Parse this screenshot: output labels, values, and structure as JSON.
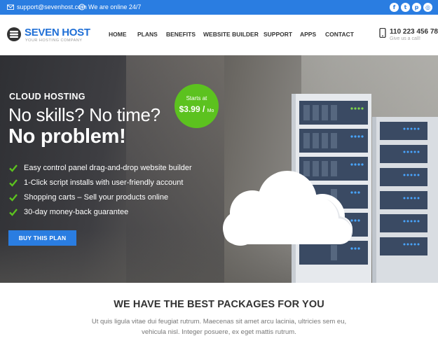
{
  "topbar": {
    "email": "support@sevenhost.com",
    "status": "We are online 24/7",
    "social": [
      {
        "name": "facebook-icon",
        "glyph": "f"
      },
      {
        "name": "twitter-icon",
        "glyph": "t"
      },
      {
        "name": "pinterest-icon",
        "glyph": "p"
      },
      {
        "name": "instagram-icon",
        "glyph": "◎"
      }
    ]
  },
  "header": {
    "logo_part1": "SEVEN",
    "logo_part2": "HOST",
    "tagline": "YOUR HOSTING COMPANY",
    "nav": [
      "HOME",
      "PLANS",
      "BENEFITS",
      "WEBSITE BUILDER",
      "SUPPORT",
      "APPS",
      "CONTACT"
    ],
    "phone": "110 223 456 78",
    "phone_sub": "Give us a call!"
  },
  "hero": {
    "kicker": "CLOUD HOSTING",
    "headline": "No skills? No time?",
    "headline_bold": "No problem!",
    "features": [
      "Easy control panel drag-and-drop website builder",
      "1-Click script installs with user-friendly account",
      "Shopping carts – Sell your products online",
      "30-day money-back guarantee"
    ],
    "cta": "BUY THIS PLAN",
    "badge": {
      "label": "Starts at",
      "price": "$3.99 /",
      "period": "Mo"
    }
  },
  "packages": {
    "title": "WE HAVE THE BEST PACKAGES FOR YOU",
    "description": "Ut quis ligula vitae dui feugiat rutrum. Maecenas sit amet arcu lacinia, ultricies sem eu, vehicula nisl. Integer posuere, ex eget mattis rutrum."
  },
  "colors": {
    "primary": "#2a7de1",
    "accent_green": "#5cc21f"
  }
}
